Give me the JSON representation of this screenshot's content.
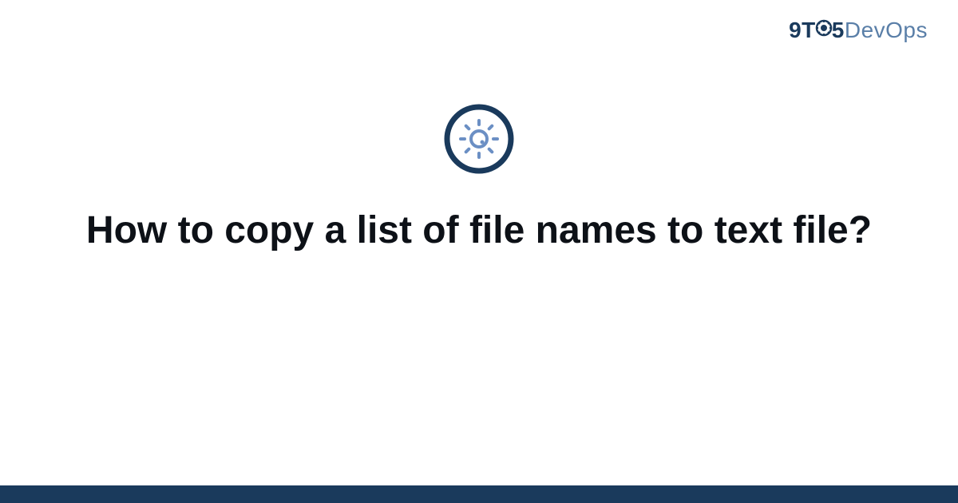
{
  "brand": {
    "part1": "9T",
    "part2": "5",
    "part3": "DevOps"
  },
  "title": "How to copy a list of file names to text file?",
  "colors": {
    "dark_blue": "#1a3a5c",
    "light_blue": "#5a7fa8",
    "icon_outer": "#1a3a5c",
    "icon_inner": "#6b8fc4",
    "text": "#0d1117"
  }
}
